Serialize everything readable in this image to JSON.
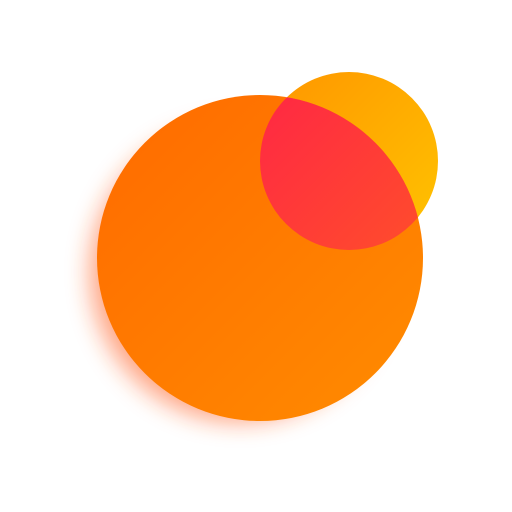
{
  "icon": {
    "name": "overlapping-circles-logo",
    "colors": {
      "background": "#ffffff",
      "large_circle_start": "#ff6a00",
      "large_circle_end": "#ff8c00",
      "large_circle_shadow": "#ff5a1f",
      "small_circle_start": "#ff9500",
      "small_circle_end": "#ffc400",
      "overlap_start": "#ff1f4b",
      "overlap_end": "#ff4a2e"
    }
  }
}
